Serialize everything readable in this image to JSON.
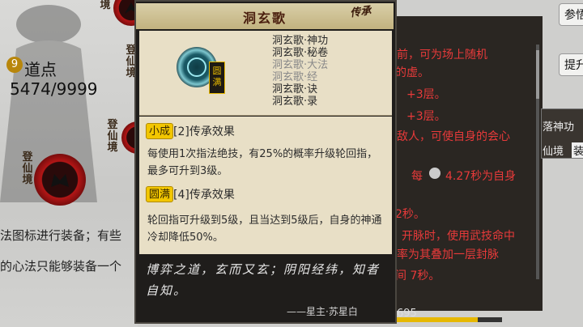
{
  "background": {
    "medals": [
      "境",
      "登仙境",
      "登仙境",
      "登仙境"
    ],
    "daodian_label": "道点",
    "daodian_count": "5474/9999",
    "text_lines": [
      "法图标进行装备；有些",
      "的心法只能够装备一个"
    ]
  },
  "right_panel": {
    "lines": [
      "前，可为场上随机",
      "的虚。",
      "+3层。",
      "+3层。",
      "敌人，可使自身的会心",
      "每",
      "4.27秒为自身",
      "2秒。",
      "开脉时，使用武技命中",
      "率为其叠加一层封脉",
      "间 7秒。"
    ],
    "buttons": [
      "参悟",
      "提升"
    ],
    "side_text": [
      "落神功",
      "仙境",
      "装"
    ],
    "bottom_number": "695"
  },
  "popup": {
    "title": "洞玄歌",
    "corner_seal": "传承",
    "level_badge": "圆满",
    "skills": [
      {
        "label": "洞玄歌·神功",
        "active": true
      },
      {
        "label": "洞玄歌·秘卷",
        "active": true
      },
      {
        "label": "洞玄歌·大法",
        "active": false
      },
      {
        "label": "洞玄歌·经",
        "active": false
      },
      {
        "label": "洞玄歌·诀",
        "active": true
      },
      {
        "label": "洞玄歌·录",
        "active": true
      }
    ],
    "effects": [
      {
        "badge": "小成",
        "title": "[2]传承效果",
        "text": "每使用1次指法绝技，有25%的概率升级轮回指，最多可升到3级。"
      },
      {
        "badge": "圆满",
        "title": "[4]传承效果",
        "text": "轮回指可升级到5级，且当达到5级后，自身的神通冷却降低50%。"
      }
    ],
    "poem": "博弈之道，玄而又玄；阴阳经纬，知者自知。",
    "author": "——星主·苏星白"
  },
  "colors": {
    "red_text": "#e83a3a",
    "gold": "#e6a500",
    "parchment": "#e8dfc6",
    "badge_yellow": "#f2c600"
  }
}
